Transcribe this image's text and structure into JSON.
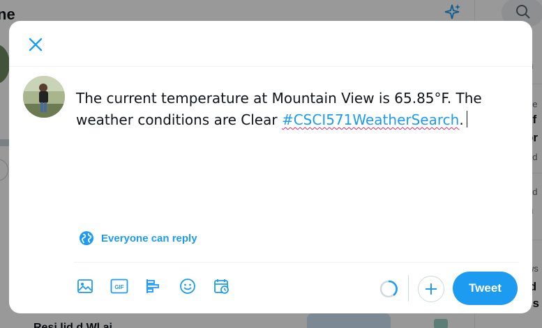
{
  "background": {
    "page_title_fragment": "ne",
    "right_column": [
      {
        "text": "h"
      },
      {
        "small": "ne"
      },
      {
        "text": "lif"
      },
      {
        "text": "or"
      },
      {
        "small": "nd"
      },
      {
        "small": "nd"
      },
      {
        "text": "n"
      },
      {
        "small": "ws"
      },
      {
        "text": "ld"
      },
      {
        "text": "es"
      }
    ],
    "bottom_text_fragment": "Resi    lid    d Wl    ai"
  },
  "composer": {
    "tweet_text_before": "The current temperature at Mountain View is 65.85°F. The weather conditions are Clear ",
    "hashtag": "#CSCI571WeatherSearch",
    "tweet_text_after": ".",
    "reply_setting": "Everyone can reply",
    "tweet_button": "Tweet",
    "toolbar_icons": [
      "image-icon",
      "gif-icon",
      "poll-icon",
      "emoji-icon",
      "schedule-icon"
    ],
    "gif_label": "GIF"
  },
  "colors": {
    "accent": "#1d9bf0",
    "text": "#0f1419",
    "spellcheck": "#e0245e"
  }
}
